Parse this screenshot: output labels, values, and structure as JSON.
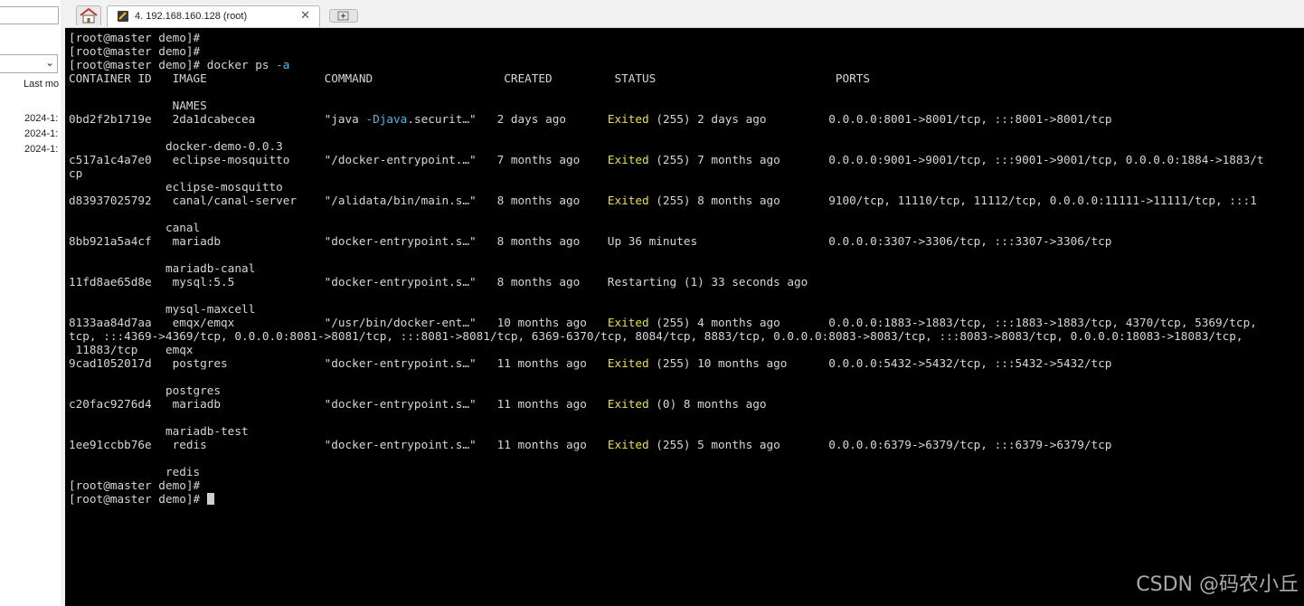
{
  "left_panel": {
    "column_header": "Last mo",
    "rows": [
      "2024-1:",
      "2024-1:",
      "2024-1:"
    ]
  },
  "tabs": {
    "session_label": "4. 192.168.160.128 (root)",
    "close_glyph": "✕"
  },
  "terminal": {
    "lines": [
      [
        {
          "t": "[root@master demo]#"
        }
      ],
      [
        {
          "t": "[root@master demo]#"
        }
      ],
      [
        {
          "t": "[root@master demo]# docker ps "
        },
        {
          "t": "-a",
          "c": "cyan"
        }
      ],
      [
        {
          "t": "CONTAINER ID   IMAGE                 COMMAND                   CREATED         STATUS                          PORTS"
        }
      ],
      [
        {
          "t": ""
        }
      ],
      [
        {
          "t": "               NAMES"
        }
      ],
      [
        {
          "t": "0bd2f2b1719e   2da1dcabecea          \"java "
        },
        {
          "t": "-Djava",
          "c": "cyan"
        },
        {
          "t": ".securit…\"   2 days ago      "
        },
        {
          "t": "Exited",
          "c": "yellow"
        },
        {
          "t": " (255) 2 days ago         0.0.0.0:8001->8001/tcp, :::8001->8001/tcp"
        }
      ],
      [
        {
          "t": ""
        }
      ],
      [
        {
          "t": "              docker-demo-0.0.3"
        }
      ],
      [
        {
          "t": "c517a1c4a7e0   eclipse-mosquitto     \"/docker-entrypoint.…\"   7 months ago    "
        },
        {
          "t": "Exited",
          "c": "yellow"
        },
        {
          "t": " (255) 7 months ago       0.0.0.0:9001->9001/tcp, :::9001->9001/tcp, 0.0.0.0:1884->1883/t"
        }
      ],
      [
        {
          "t": "cp"
        }
      ],
      [
        {
          "t": "              eclipse-mosquitto"
        }
      ],
      [
        {
          "t": "d83937025792   canal/canal-server    \"/alidata/bin/main.s…\"   8 months ago    "
        },
        {
          "t": "Exited",
          "c": "yellow"
        },
        {
          "t": " (255) 8 months ago       9100/tcp, 11110/tcp, 11112/tcp, 0.0.0.0:11111->11111/tcp, :::1"
        }
      ],
      [
        {
          "t": ""
        }
      ],
      [
        {
          "t": "              canal"
        }
      ],
      [
        {
          "t": "8bb921a5a4cf   mariadb               \"docker-entrypoint.s…\"   8 months ago    Up 36 minutes                   0.0.0.0:3307->3306/tcp, :::3307->3306/tcp"
        }
      ],
      [
        {
          "t": ""
        }
      ],
      [
        {
          "t": "              mariadb-canal"
        }
      ],
      [
        {
          "t": "11fd8ae65d8e   mysql:5.5             \"docker-entrypoint.s…\"   8 months ago    Restarting (1) 33 seconds ago"
        }
      ],
      [
        {
          "t": ""
        }
      ],
      [
        {
          "t": "              mysql-maxcell"
        }
      ],
      [
        {
          "t": "8133aa84d7aa   emqx/emqx             \"/usr/bin/docker-ent…\"   10 months ago   "
        },
        {
          "t": "Exited",
          "c": "yellow"
        },
        {
          "t": " (255) 4 months ago       0.0.0.0:1883->1883/tcp, :::1883->1883/tcp, 4370/tcp, 5369/tcp,"
        }
      ],
      [
        {
          "t": "tcp, :::4369->4369/tcp, 0.0.0.0:8081->8081/tcp, :::8081->8081/tcp, 6369-6370/tcp, 8084/tcp, 8883/tcp, 0.0.0.0:8083->8083/tcp, :::8083->8083/tcp, 0.0.0.0:18083->18083/tcp,"
        }
      ],
      [
        {
          "t": " 11883/tcp    emqx"
        }
      ],
      [
        {
          "t": "9cad1052017d   postgres              \"docker-entrypoint.s…\"   11 months ago   "
        },
        {
          "t": "Exited",
          "c": "yellow"
        },
        {
          "t": " (255) 10 months ago      0.0.0.0:5432->5432/tcp, :::5432->5432/tcp"
        }
      ],
      [
        {
          "t": ""
        }
      ],
      [
        {
          "t": "              postgres"
        }
      ],
      [
        {
          "t": "c20fac9276d4   mariadb               \"docker-entrypoint.s…\"   11 months ago   "
        },
        {
          "t": "Exited",
          "c": "yellow"
        },
        {
          "t": " (0) 8 months ago"
        }
      ],
      [
        {
          "t": ""
        }
      ],
      [
        {
          "t": "              mariadb-test"
        }
      ],
      [
        {
          "t": "1ee91ccbb76e   redis                 \"docker-entrypoint.s…\"   11 months ago   "
        },
        {
          "t": "Exited",
          "c": "yellow"
        },
        {
          "t": " (255) 5 months ago       0.0.0.0:6379->6379/tcp, :::6379->6379/tcp"
        }
      ],
      [
        {
          "t": ""
        }
      ],
      [
        {
          "t": "              redis"
        }
      ],
      [
        {
          "t": "[root@master demo]#"
        }
      ],
      [
        {
          "t": "[root@master demo]# "
        },
        {
          "cursor": true
        }
      ]
    ]
  },
  "watermark": "CSDN @码农小丘",
  "colors": {
    "terminal_bg": "#000000",
    "text": "#d6d6d6",
    "exited": "#e8e04a",
    "option_flag": "#56b6e8"
  }
}
